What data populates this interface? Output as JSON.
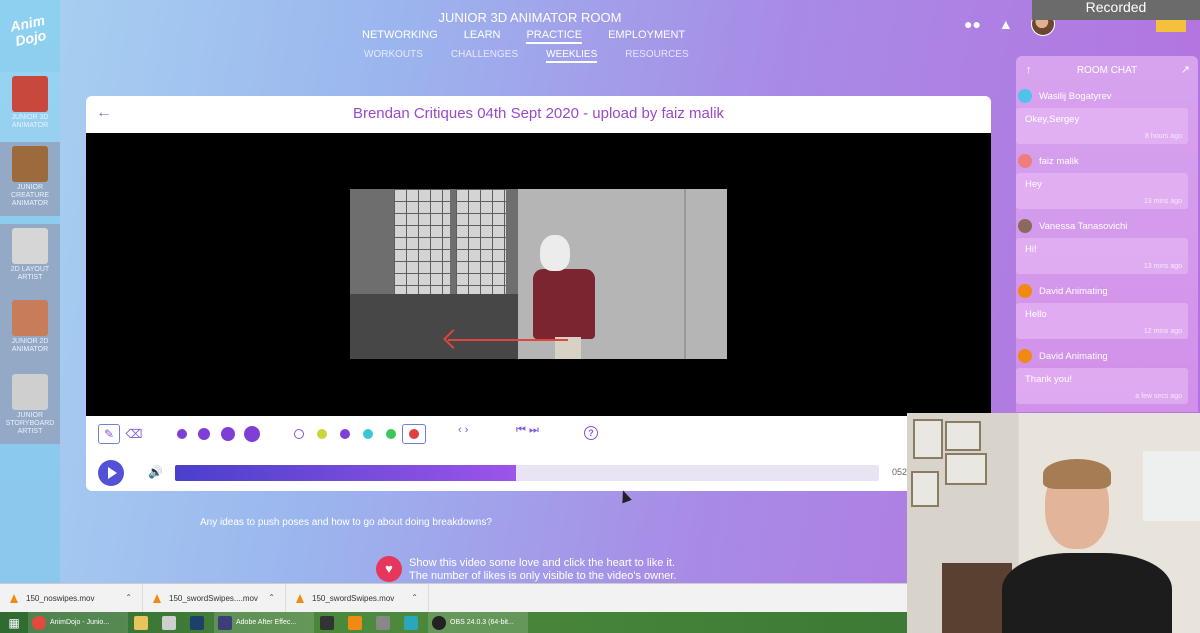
{
  "app": {
    "logo_text": "Anim Dojo"
  },
  "sidebar": {
    "rooms": [
      {
        "label": "JUNIOR 3D ANIMATOR",
        "thumb_color": "#c9483d"
      },
      {
        "label": "JUNIOR CREATURE ANIMATOR",
        "thumb_color": "#9d6a3b"
      },
      {
        "label": "2D LAYOUT ARTIST",
        "thumb_color": "#d6d6d6"
      },
      {
        "label": "JUNIOR 2D ANIMATOR",
        "thumb_color": "#c77d59"
      },
      {
        "label": "JUNIOR STORYBOARD ARTIST",
        "thumb_color": "#cfcfcf"
      }
    ]
  },
  "header": {
    "title": "JUNIOR 3D ANIMATOR ROOM",
    "nav": [
      "NETWORKING",
      "LEARN",
      "PRACTICE",
      "EMPLOYMENT"
    ],
    "subnav": [
      "WORKOUTS",
      "CHALLENGES",
      "WEEKLIES",
      "RESOURCES"
    ],
    "recorded": "Recorded"
  },
  "card": {
    "title": "Brendan Critiques 04th Sept 2020 - upload by faiz malik",
    "back_icon": "←",
    "time": "052",
    "progress": 0.485
  },
  "toolbar": {
    "brush_sizes": [
      10,
      12,
      14,
      16
    ],
    "brush_color": "#7f3fd6",
    "colors": [
      "#ffffff",
      "#c9d63a",
      "#7f3fd6",
      "#3ac7d6",
      "#3ac75a",
      "#e04040"
    ],
    "selected_color": "#e04040",
    "nav_glyphs": [
      "‹ ›",
      "⏮ ⏭"
    ],
    "help": "?"
  },
  "question": "Any ideas to push poses and how to go about doing breakdowns?",
  "love": {
    "line1": "Show this video some love and click the heart to like it.",
    "line2": "The number of likes is only visible to the video's owner."
  },
  "chat": {
    "title": "ROOM CHAT",
    "messages": [
      {
        "user": "Wasilij Bogatyrev",
        "text": "Okey,Sergey",
        "when": "8 hours ago",
        "color": "#4fc3e8"
      },
      {
        "user": "faiz malik",
        "text": "Hey",
        "when": "13 mins ago",
        "color": "#f07c7c"
      },
      {
        "user": "Vanessa Tanasovichi",
        "text": "Hi!",
        "when": "13 mins ago",
        "color": "#8a6a5a"
      },
      {
        "user": "David Animating",
        "text": "Hello",
        "when": "12 mins ago",
        "color": "#f08a12"
      },
      {
        "user": "David Animating",
        "text": "Thank you!",
        "when": "a few secs ago",
        "color": "#f08a12"
      }
    ]
  },
  "downloads": [
    "150_noswipes.mov",
    "150_swordSwipes....mov",
    "150_swordSwipes.mov"
  ],
  "taskbar": {
    "items": [
      {
        "label": "AnimDojo - Junio...",
        "color": "#e24b3b"
      },
      {
        "label": "Adobe After Effec...",
        "color": "#3d3d7a"
      },
      {
        "label": "OBS 24.0.3 (64-bit...",
        "color": "#222222"
      }
    ]
  }
}
